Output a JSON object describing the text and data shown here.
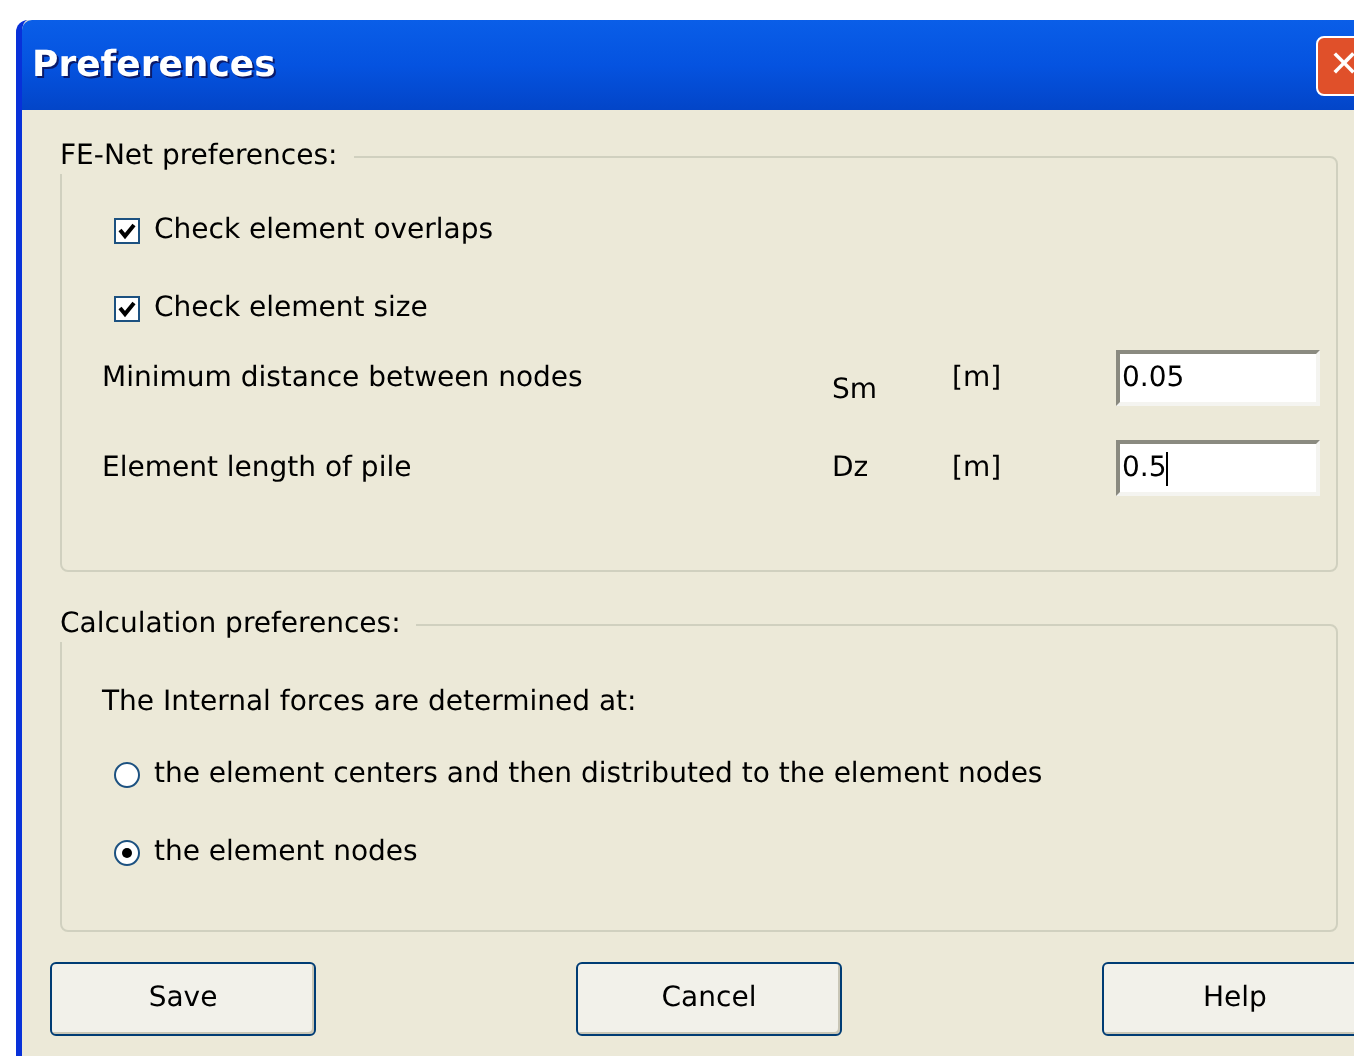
{
  "window": {
    "title": "Preferences",
    "close": "✕"
  },
  "fe_net": {
    "title": "FE-Net preferences:",
    "checkboxes": [
      {
        "label": "Check element overlaps",
        "checked": true
      },
      {
        "label": "Check element size",
        "checked": true
      }
    ],
    "fields": [
      {
        "label": "Minimum distance between nodes",
        "symbol": "Sm",
        "unit": "[m]",
        "value": "0.05",
        "focused": false
      },
      {
        "label": "Element length of pile",
        "symbol": "Dz",
        "unit": "[m]",
        "value": "0.5",
        "focused": true
      }
    ]
  },
  "calculation": {
    "title": "Calculation preferences:",
    "prompt": "The Internal forces are determined at:",
    "options": [
      {
        "label": "the element centers and then distributed to the element nodes",
        "selected": false
      },
      {
        "label": "the element nodes",
        "selected": true
      }
    ]
  },
  "buttons": [
    "Save",
    "Cancel",
    "Help"
  ]
}
